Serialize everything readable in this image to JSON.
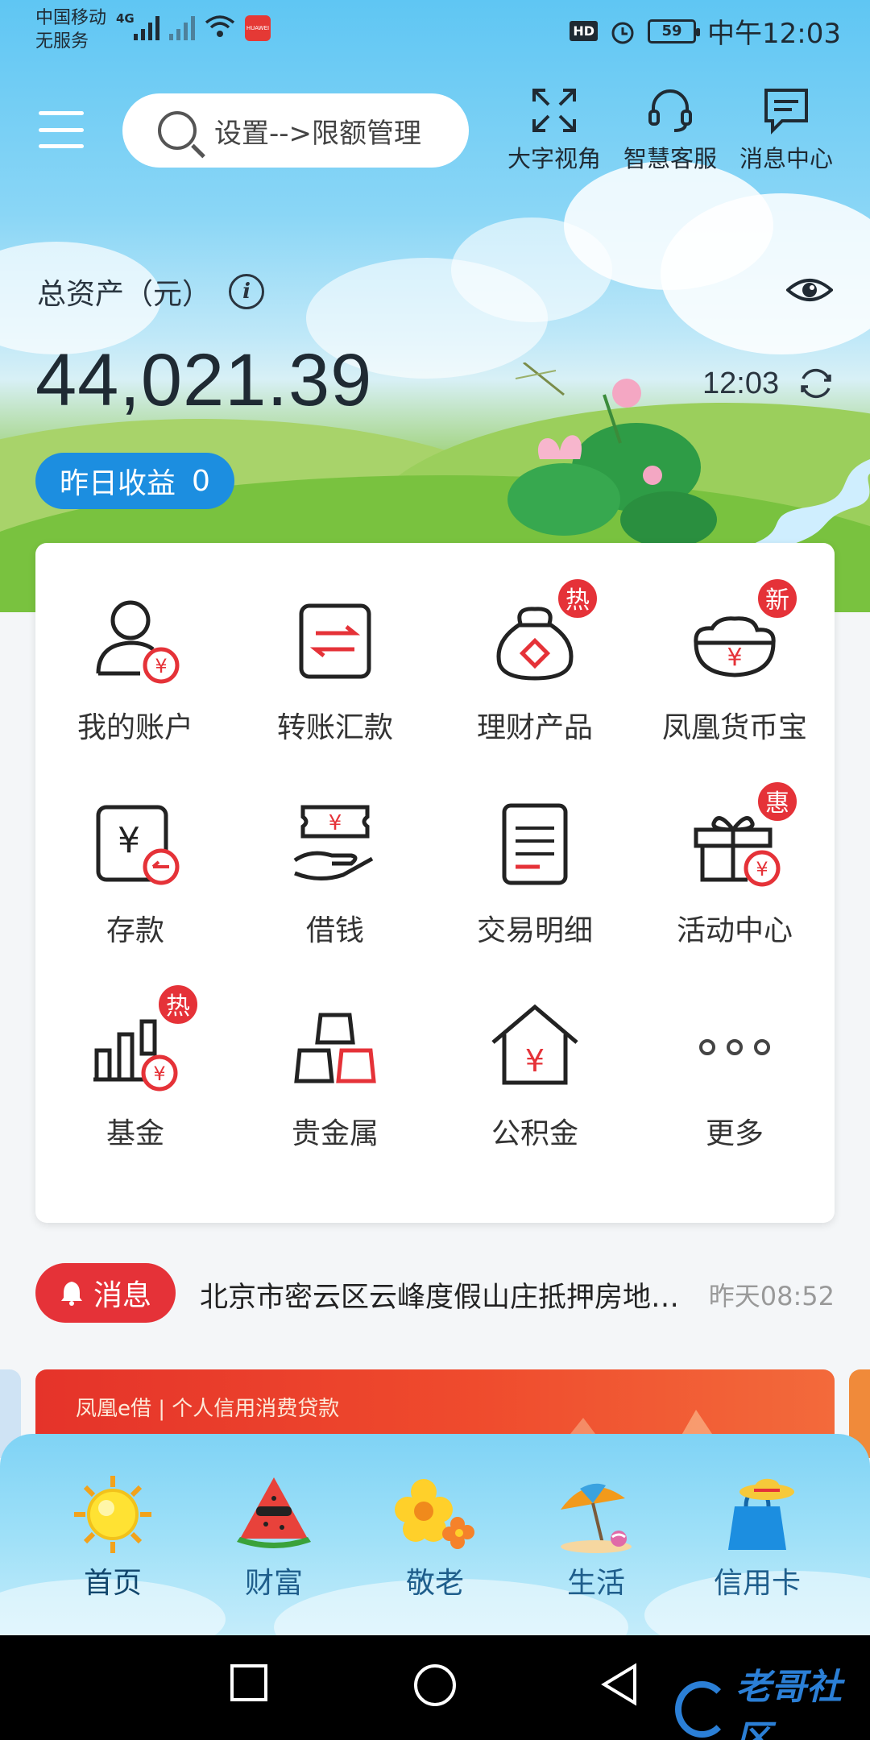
{
  "status_bar": {
    "carrier_line1": "中国移动",
    "carrier_line2": "无服务",
    "network": "4G",
    "hd": "HD",
    "battery": "59",
    "time": "中午12:03"
  },
  "top_bar": {
    "search_placeholder": "设置-->限额管理",
    "actions": [
      {
        "label": "大字视角",
        "icon": "expand-icon"
      },
      {
        "label": "智慧客服",
        "icon": "headset-icon"
      },
      {
        "label": "消息中心",
        "icon": "message-icon"
      }
    ]
  },
  "assets": {
    "label": "总资产（元）",
    "info": "i",
    "value": "44,021.39",
    "refresh_time": "12:03",
    "yesterday_label": "昨日收益",
    "yesterday_value": "0"
  },
  "grid": {
    "items": [
      {
        "label": "我的账户",
        "icon": "account-icon",
        "badge": ""
      },
      {
        "label": "转账汇款",
        "icon": "transfer-icon",
        "badge": ""
      },
      {
        "label": "理财产品",
        "icon": "money-bag-icon",
        "badge": "热"
      },
      {
        "label": "凤凰货币宝",
        "icon": "currency-treasure-icon",
        "badge": "新"
      },
      {
        "label": "存款",
        "icon": "deposit-icon",
        "badge": ""
      },
      {
        "label": "借钱",
        "icon": "loan-icon",
        "badge": ""
      },
      {
        "label": "交易明细",
        "icon": "transaction-detail-icon",
        "badge": ""
      },
      {
        "label": "活动中心",
        "icon": "gift-icon",
        "badge": "惠"
      },
      {
        "label": "基金",
        "icon": "fund-chart-icon",
        "badge": "热"
      },
      {
        "label": "贵金属",
        "icon": "gold-bars-icon",
        "badge": ""
      },
      {
        "label": "公积金",
        "icon": "house-fund-icon",
        "badge": ""
      },
      {
        "label": "更多",
        "icon": "more-dots-icon",
        "badge": ""
      }
    ]
  },
  "message": {
    "label": "消息",
    "text": "北京市密云区云峰度假山庄抵押房地…",
    "time": "昨天08:52"
  },
  "banner": {
    "text": "凤凰e借 | 个人信用消费贷款"
  },
  "tabs": [
    {
      "label": "首页",
      "icon": "sun-icon",
      "active": true
    },
    {
      "label": "财富",
      "icon": "watermelon-icon",
      "active": false
    },
    {
      "label": "敬老",
      "icon": "flower-icon",
      "active": false
    },
    {
      "label": "生活",
      "icon": "beach-umbrella-icon",
      "active": false
    },
    {
      "label": "信用卡",
      "icon": "shopping-bag-icon",
      "active": false
    }
  ],
  "watermark": "老哥社区",
  "colors": {
    "accent_red": "#e53238",
    "accent_blue": "#1c8ee0",
    "sky": "#5fc6f3"
  }
}
